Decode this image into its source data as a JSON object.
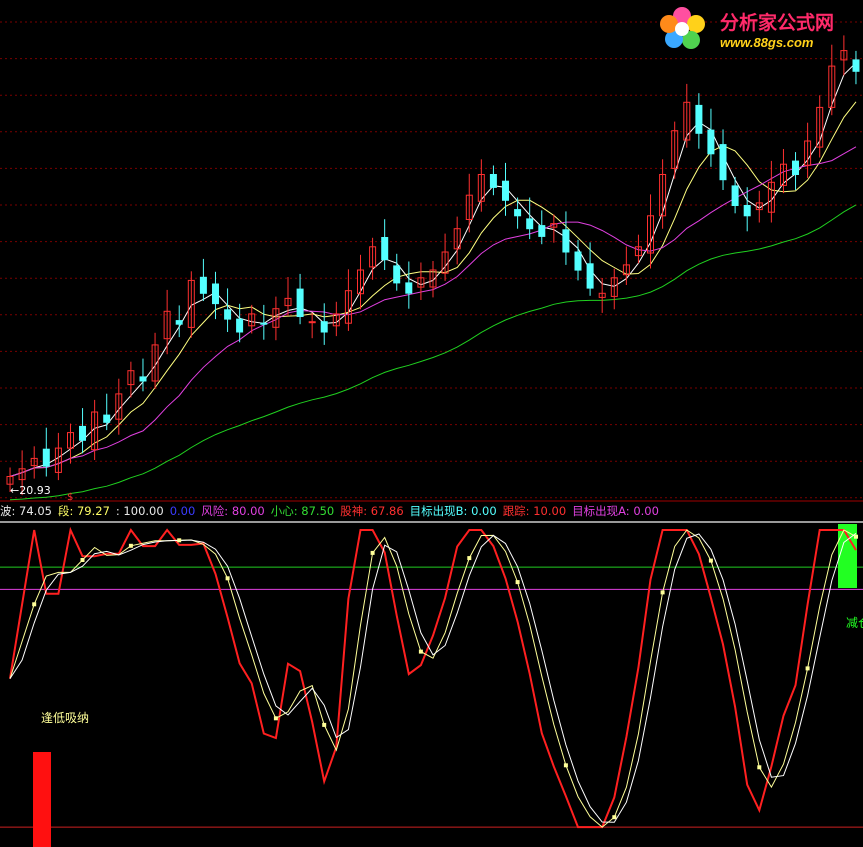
{
  "watermark": {
    "title": "分析家公式网",
    "url": "www.88gs.com"
  },
  "price_panel": {
    "low_marker": "←20.93",
    "low_value": 20.93,
    "signal_glyph": "$",
    "colors": {
      "up_candle": "#ff3030",
      "down_candle": "#54ffff",
      "ma_short": "#ffffff",
      "ma_mid": "#ffff80",
      "ma_long": "#e040e0",
      "ma_trend": "#20d020",
      "grid": "#7a0000"
    }
  },
  "indicator_readout": {
    "items": [
      {
        "label": "波: 74.05",
        "color": "#e8e8e8"
      },
      {
        "label": "段: 79.27",
        "color": "#ffff66"
      },
      {
        "label": ": 100.00",
        "color": "#e8e8e8"
      },
      {
        "label": "0.00",
        "color": "#3b3bff"
      },
      {
        "label": "风险: 80.00",
        "color": "#e040e0"
      },
      {
        "label": "小心: 87.50",
        "color": "#33dd33"
      },
      {
        "label": "股神: 67.86",
        "color": "#ff3030"
      },
      {
        "label": "目标出现B: 0.00",
        "color": "#54ffff"
      },
      {
        "label": "跟踪: 10.00",
        "color": "#ff3030"
      },
      {
        "label": "目标出现A: 0.00",
        "color": "#e040e0"
      }
    ]
  },
  "indicator_panel": {
    "buy_label": "逢低吸纳",
    "sell_label": "减仓",
    "level_green": 87.5,
    "level_magenta": 80,
    "level_red": 0,
    "colors": {
      "wave": "#ff2020",
      "segment": "#ffff99",
      "smooth": "#ffffff",
      "buy_bar": "#ff1010",
      "sell_bar": "#22ff22",
      "level_green": "#22cc22",
      "level_magenta": "#e040e0",
      "level_red": "#cc2020"
    }
  },
  "chart_data": [
    {
      "type": "candlestick",
      "title": "",
      "annotations": [
        "←20.93",
        "$"
      ],
      "low": 20.93,
      "series": [
        {
          "close": [
            20.9,
            21.2,
            21.6,
            21.3,
            22.0,
            22.6,
            22.3,
            23.4,
            23.0,
            24.1,
            25.0,
            24.6,
            26.0,
            27.3,
            26.8,
            28.5,
            28.0,
            27.6,
            27.0,
            26.5,
            27.2,
            26.8,
            27.4,
            27.8,
            27.1,
            26.9,
            26.5,
            27.2,
            28.1,
            28.9,
            29.8,
            29.3,
            28.4,
            28.0,
            28.6,
            28.9,
            29.6,
            30.5,
            31.8,
            32.6,
            32.1,
            31.6,
            31.0,
            30.5,
            30.2,
            30.7,
            29.6,
            28.9,
            28.2,
            28.0,
            28.6,
            29.1,
            29.8,
            31.0,
            32.6,
            34.3,
            35.4,
            34.2,
            33.4,
            32.4,
            31.4,
            31.0,
            31.5,
            32.3,
            33.0,
            32.6,
            33.9,
            35.2,
            36.8,
            37.4,
            36.6
          ]
        }
      ]
    },
    {
      "type": "line",
      "title": "",
      "ylim": [
        -5,
        100
      ],
      "series": [
        {
          "name": "波",
          "last": 74.05
        },
        {
          "name": "段",
          "last": 79.27
        },
        {
          "name": "风险",
          "values": [
            80
          ]
        },
        {
          "name": "小心",
          "values": [
            87.5
          ]
        },
        {
          "name": "股神",
          "last": 67.86
        },
        {
          "name": "跟踪",
          "last": 10.0
        }
      ],
      "annotations": [
        "逢低吸纳",
        "减仓"
      ]
    }
  ]
}
